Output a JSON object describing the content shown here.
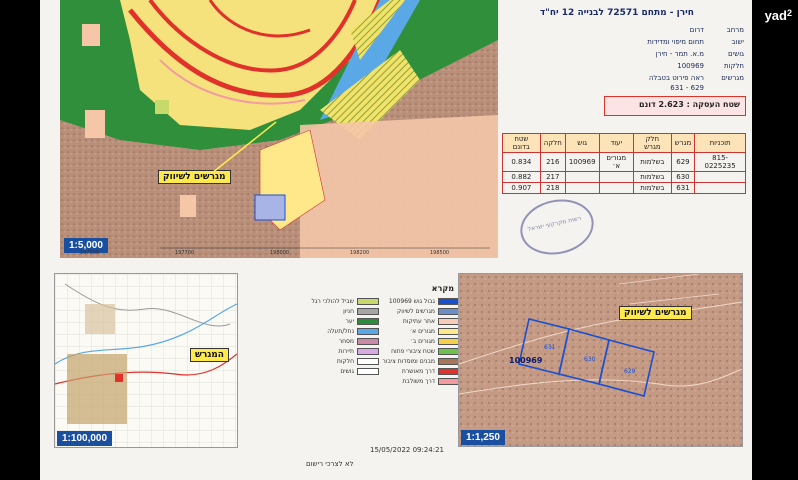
{
  "brand": {
    "name": "yad2",
    "mark": "yad",
    "num": "2"
  },
  "header": {
    "title": "חירן - מתחם 72571 לבנייה 12 יח\"ד",
    "rows": [
      {
        "label": "מרחב",
        "value": "דרום"
      },
      {
        "label": "ישוב",
        "value": "תחום מיפוי ומדידות"
      },
      {
        "label": "גושים",
        "value": "מ.א. תמר - חירן"
      },
      {
        "label": "חלקות",
        "value": "100969"
      },
      {
        "label": "מגרשים",
        "value": "ראה פירוט בטבלה"
      },
      {
        "label": "",
        "value": "629 - 631"
      }
    ],
    "area_label": "שטח העסקה : 2.623 דונם"
  },
  "table": {
    "headers": [
      "תוכניות",
      "מגרש",
      "חלק מגרש",
      "יעוד",
      "גוש",
      "חלקה",
      "שטח בדונם"
    ],
    "rows": [
      [
        "815-0225235",
        "629",
        "בשלמות",
        "מגורים א׳",
        "100969",
        "216",
        "0.834"
      ],
      [
        "",
        "630",
        "בשלמות",
        "",
        "",
        "217",
        "0.882"
      ],
      [
        "",
        "631",
        "בשלמות",
        "",
        "",
        "218",
        "0.907"
      ]
    ]
  },
  "map_main": {
    "scale": "1:5,000",
    "callout": "מגרשים לשיווק",
    "coords_bottom": [
      "197500",
      "197700",
      "198000",
      "198200",
      "198500"
    ],
    "coords_side": [
      "575700",
      "575600"
    ]
  },
  "map_small": {
    "scale": "1:100,000",
    "callout": "המגרש",
    "coords_top": [
      "199800",
      "200000"
    ],
    "coords_bottom": [
      "196500",
      "200600"
    ]
  },
  "map_zoom": {
    "scale": "1:1,250",
    "callout": "מגרשים לשיווק",
    "block": "100969",
    "coords_top": [
      "198000",
      "198100",
      "198150"
    ],
    "coords_bottom": [
      "198050",
      "198100",
      "198150"
    ],
    "parcels": [
      "631",
      "630",
      "629"
    ]
  },
  "legend": {
    "title": "מקרא",
    "items": [
      {
        "label": "גבול גוש 100969",
        "color": "#1a4fd0"
      },
      {
        "label": "מגרשים לשיווק",
        "color": "#6b8fc6"
      },
      {
        "label": "אתר עתיקות",
        "color": "#f7cdb8"
      },
      {
        "label": "מגורים א׳",
        "color": "#ffe88a"
      },
      {
        "label": "מגורים ב׳",
        "color": "#f5d04a"
      },
      {
        "label": "שטח ציבורי פתוח",
        "color": "#6cc24a"
      },
      {
        "label": "מבנים ומוסדות ציבור",
        "color": "#a8745a"
      },
      {
        "label": "דרך מאושרת",
        "color": "#e0312a"
      },
      {
        "label": "דרך משולבת",
        "color": "#f29ca0"
      },
      {
        "label": "שביל להולכי רגל",
        "color": "#c7d96a"
      },
      {
        "label": "חניון",
        "color": "#a6a6a6"
      },
      {
        "label": "יער",
        "color": "#2e8b3a"
      },
      {
        "label": "נחל/תעלה",
        "color": "#5aa8e6"
      },
      {
        "label": "מסחר",
        "color": "#c98aa8"
      },
      {
        "label": "תיירות",
        "color": "#d9a8e6"
      },
      {
        "label": "חלקות",
        "color": "#ffffff"
      },
      {
        "label": "גושים",
        "color": "#ffffff"
      }
    ]
  },
  "footer": {
    "stamp": "15/05/2022 09:24:21",
    "note": "לא לצרכי רישום"
  },
  "seal": "רשות מקרקעי ישראל"
}
